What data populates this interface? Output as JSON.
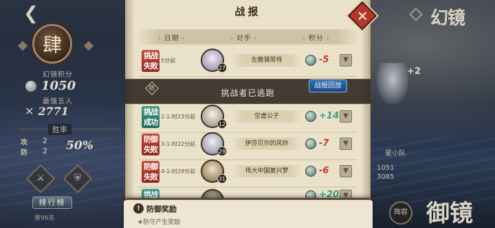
{
  "left": {
    "rank_char": "肆",
    "score_label": "幻镜积分",
    "score_value": "1050",
    "power_label": "最强五人",
    "power_value": "2771",
    "winrate_label": "胜率",
    "attack_label": "攻",
    "attack_count": "2",
    "defense_label": "防",
    "defense_count": "2",
    "winrate_value": "50%",
    "rank_button_label": "排行榜",
    "rank_sub_text": "第96名"
  },
  "right": {
    "title": "幻镜",
    "plus_text": "+2",
    "team_label": "星小队",
    "num1": "1051",
    "num2": "3085",
    "bottom_title": "御镜",
    "bottom_icon_label": "阵容"
  },
  "report": {
    "title": "战报",
    "headers": {
      "date": "日期",
      "opponent": "对手",
      "points": "积分"
    },
    "rows": [
      {
        "result": "挑战失败",
        "result_type": "loss",
        "date": "5分前",
        "opponent": "左散骑常侍",
        "level": "27",
        "points": "-5",
        "avatar_color": "#c9c4d6"
      },
      {
        "result": "挑战成功",
        "result_type": "win",
        "date": "2-1-时23分前",
        "opponent": "空虚公子",
        "level": "12",
        "points": "+14",
        "avatar_color": "#d7d2c7"
      },
      {
        "result": "防御失败",
        "result_type": "loss",
        "date": "3-1-时22分前",
        "opponent": "伊莎贝尔的风铃",
        "level": "29",
        "points": "-7",
        "avatar_color": "#c8c6d2"
      },
      {
        "result": "防御失败",
        "result_type": "loss",
        "date": "4-1-时29分前",
        "opponent": "伟大中国复兴梦",
        "level": "31",
        "points": "-6",
        "avatar_color": "#bfae8a"
      },
      {
        "result": "挑战",
        "result_type": "win",
        "date": "",
        "opponent": "",
        "level": "",
        "points": "+20",
        "avatar_color": "#8a8378"
      }
    ],
    "overlay_text": "挑战者已逃跑",
    "overlay_tag": "防",
    "replay_label": "战报回放"
  },
  "defense_reward": {
    "icon": "!",
    "title": "防御奖励",
    "subtitle": "★防守产生奖励"
  },
  "colors": {
    "loss": "#b3372a",
    "win": "#2f8a76",
    "negative_points": "#c23a2a",
    "positive_points": "#3aa084"
  }
}
